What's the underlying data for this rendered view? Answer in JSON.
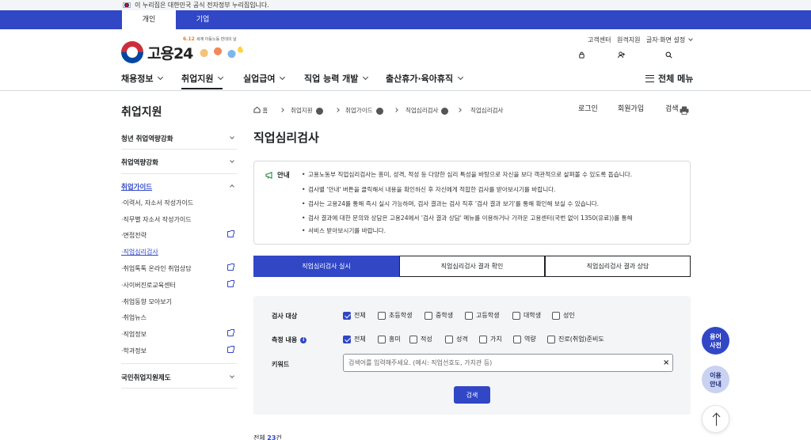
{
  "gov_banner": "이 누리집은 대한민국 공식 전자정부 누리집입니다.",
  "top_tabs": [
    "개인",
    "기업"
  ],
  "logo": {
    "name": "고용24",
    "event_date": "6.12",
    "event_text": "세계 아동노동 반대의 날"
  },
  "utility": [
    "고객센터",
    "원격지원",
    "글자·화면 설정"
  ],
  "actions": {
    "login": "로그인",
    "signup": "회원가입",
    "search": "검색"
  },
  "gnb": [
    "채용정보",
    "취업지원",
    "실업급여",
    "직업 능력 개발",
    "출산휴가·육아휴직"
  ],
  "all_menu": "전체 메뉴",
  "lnb": {
    "title": "취업지원",
    "sections": [
      "청년 취업역량강화",
      "취업역량강화",
      "취업가이드",
      "국민취업지원제도"
    ],
    "sub_items": [
      "이력서, 자소서 작성가이드",
      "직무별 자소서 작성가이드",
      "면접전략",
      "직업심리검사",
      "취업톡톡 온라인 취업상담",
      "사이버진로교육센터",
      "취업동향 모아보기",
      "취업뉴스",
      "직업정보",
      "학과정보"
    ]
  },
  "breadcrumb": [
    "홈",
    "취업지원",
    "취업가이드",
    "직업심리검사",
    "직업심리검사"
  ],
  "page_title": "직업심리검사",
  "notice": {
    "label": "안내",
    "lines": [
      "고용노동부 직업심리검사는 흥미, 성격, 적성 등 다양한 심리 특성을 바탕으로 자신을 보다 객관적으로 살펴볼 수 있도록 돕습니다.",
      "검사별 '안내' 버튼을 클릭해서 내용을 확인하신 후 자신에게 적합한 검사를 받아보시기를 바랍니다.",
      "검사는 고용24를 통해 즉시 실시 가능하며, 검사 결과는 검사 직후 '검사 결과 보기'를 통해 확인해 보실 수 있습니다.",
      "검사 결과에 대한 문의와 상담은 고용24에서 '검사 결과 상담' 메뉴를 이용하거나 가까운 고용센터(국번 없이 1350(유료))를 통해",
      "서비스 받아보시기를 바랍니다."
    ]
  },
  "tabs": [
    "직업심리검사 실시",
    "직업심리검사 결과 확인",
    "직업심리검사 결과 상담"
  ],
  "filters": {
    "target_label": "검사 대상",
    "target_options": [
      "전체",
      "초등학생",
      "중학생",
      "고등학생",
      "대학생",
      "성인"
    ],
    "content_label": "측정 내용",
    "content_options": [
      "전체",
      "흥미",
      "적성",
      "성격",
      "가치",
      "역량",
      "진로(취업)준비도"
    ],
    "keyword_label": "키워드",
    "keyword_placeholder": "검색어를 입력해주세요. (예시: 직업선호도, 가치관 등)",
    "search_button": "검색"
  },
  "result": {
    "prefix": "전체 ",
    "count": "23",
    "suffix": "건"
  },
  "floating": {
    "glossary_1": "용어",
    "glossary_2": "사전",
    "guide_1": "이용",
    "guide_2": "안내"
  }
}
